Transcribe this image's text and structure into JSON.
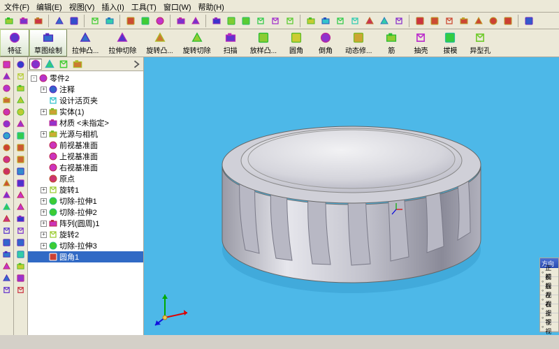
{
  "menu": [
    "文件(F)",
    "编辑(E)",
    "视图(V)",
    "插入(I)",
    "工具(T)",
    "窗口(W)",
    "帮助(H)"
  ],
  "toolbar1_icons": [
    "new-icon",
    "open-icon",
    "save-icon",
    "sep",
    "print-icon",
    "preview-icon",
    "sep",
    "undo-icon",
    "redo-icon",
    "sep",
    "select-icon",
    "rebuild-icon",
    "options-icon",
    "sep",
    "fm1-icon",
    "fm2-icon",
    "sep",
    "box-icon",
    "shade1-icon",
    "shade2-icon",
    "wire-icon",
    "hidden-icon",
    "shade3-icon",
    "sep",
    "zoom-fit-icon",
    "zoom-area-icon",
    "zoom-prev-icon",
    "pan-icon",
    "rotate-icon",
    "zoom-in-icon",
    "zoom-out-icon",
    "sep",
    "v1-icon",
    "v2-icon",
    "v3-icon",
    "v4-icon",
    "v5-icon",
    "v6-icon",
    "v7-icon",
    "sep",
    "more-icon"
  ],
  "ribbon": [
    {
      "icon": "feature-icon",
      "label": "特征"
    },
    {
      "icon": "sketch-icon",
      "label": "草图绘制"
    },
    {
      "icon": "extrude-boss-icon",
      "label": "拉伸凸..."
    },
    {
      "icon": "extrude-cut-icon",
      "label": "拉伸切除"
    },
    {
      "icon": "revolve-boss-icon",
      "label": "旋转凸..."
    },
    {
      "icon": "revolve-cut-icon",
      "label": "旋转切除"
    },
    {
      "icon": "sweep-icon",
      "label": "扫描"
    },
    {
      "icon": "loft-icon",
      "label": "放样凸..."
    },
    {
      "icon": "fillet-icon",
      "label": "圆角"
    },
    {
      "icon": "chamfer-icon",
      "label": "倒角"
    },
    {
      "icon": "move-icon",
      "label": "动态修..."
    },
    {
      "icon": "rib-icon",
      "label": "筋"
    },
    {
      "icon": "shell-icon",
      "label": "抽壳"
    },
    {
      "icon": "draft-icon",
      "label": "拔模"
    },
    {
      "icon": "hole-icon",
      "label": "异型孔"
    }
  ],
  "left_tool_cols": [
    [
      "cube-icon",
      "cyl-icon",
      "rev-icon",
      "box2-icon",
      "cut1-icon",
      "hole2-icon",
      "thread-icon",
      "fillet2-icon",
      "chamfer2-icon",
      "draft2-icon",
      "shell2-icon",
      "dome-icon",
      "wrap-icon",
      "mirror-icon",
      "pattern-icon",
      "scale-icon",
      "extr2-icon",
      "lib-icon",
      "save2-icon",
      "ref-icon"
    ],
    [
      "sel-icon",
      "sk1-icon",
      "sk2-icon",
      "sk3-icon",
      "sk4-icon",
      "line-icon",
      "rect-icon",
      "circ-icon",
      "arc-icon",
      "spline-icon",
      "poly-icon",
      "point-icon",
      "text-icon",
      "dim-icon",
      "rel-icon",
      "trim-icon",
      "ext-icon",
      "off-icon",
      "mir-icon",
      "conv-icon"
    ]
  ],
  "panel_tabs": [
    "fm-tab-icon",
    "prop-tab-icon",
    "conf-tab-icon",
    "display-tab-icon"
  ],
  "tree": [
    {
      "d": 1,
      "exp": "-",
      "ico": "part-icon",
      "t": "零件2",
      "sel": false
    },
    {
      "d": 2,
      "exp": "+",
      "ico": "ann-icon",
      "t": "注释",
      "sel": false
    },
    {
      "d": 2,
      "exp": " ",
      "ico": "folder-icon",
      "t": "设计活页夹",
      "sel": false
    },
    {
      "d": 2,
      "exp": "+",
      "ico": "solid-icon",
      "t": "实体(1)",
      "sel": false
    },
    {
      "d": 2,
      "exp": " ",
      "ico": "mat-icon",
      "t": "材质 <未指定>",
      "sel": false
    },
    {
      "d": 2,
      "exp": "+",
      "ico": "light-icon",
      "t": "光源与相机",
      "sel": false
    },
    {
      "d": 2,
      "exp": " ",
      "ico": "plane-icon",
      "t": "前视基准面",
      "sel": false
    },
    {
      "d": 2,
      "exp": " ",
      "ico": "plane-icon",
      "t": "上视基准面",
      "sel": false
    },
    {
      "d": 2,
      "exp": " ",
      "ico": "plane-icon",
      "t": "右视基准面",
      "sel": false
    },
    {
      "d": 2,
      "exp": " ",
      "ico": "origin-icon",
      "t": "原点",
      "sel": false
    },
    {
      "d": 2,
      "exp": "+",
      "ico": "revolve-icon",
      "t": "旋转1",
      "sel": false
    },
    {
      "d": 2,
      "exp": "+",
      "ico": "cut-icon",
      "t": "切除-拉伸1",
      "sel": false
    },
    {
      "d": 2,
      "exp": "+",
      "ico": "cut-icon",
      "t": "切除-拉伸2",
      "sel": false
    },
    {
      "d": 2,
      "exp": "+",
      "ico": "pattern2-icon",
      "t": "阵列(圆周)1",
      "sel": false
    },
    {
      "d": 2,
      "exp": "+",
      "ico": "revolve-icon",
      "t": "旋转2",
      "sel": false
    },
    {
      "d": 2,
      "exp": "+",
      "ico": "cut-icon",
      "t": "切除-拉伸3",
      "sel": false
    },
    {
      "d": 2,
      "exp": " ",
      "ico": "fillet3-icon",
      "t": "圆角1",
      "sel": true
    }
  ],
  "float": {
    "title": "方向",
    "rows": [
      "正视",
      "前视",
      "后视",
      "左视",
      "右视",
      "上视",
      "下视"
    ]
  }
}
